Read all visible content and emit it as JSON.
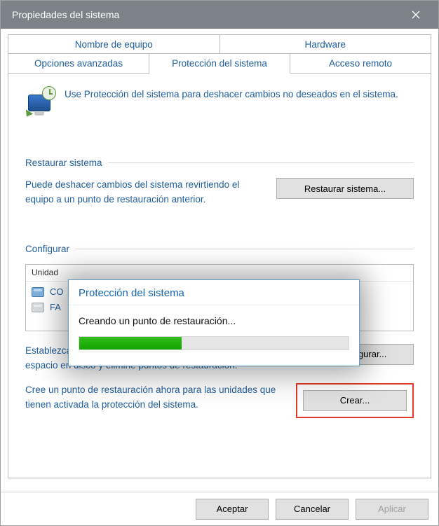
{
  "window": {
    "title": "Propiedades del sistema"
  },
  "tabs": {
    "row1": [
      {
        "label": "Nombre de equipo"
      },
      {
        "label": "Hardware"
      }
    ],
    "row2": [
      {
        "label": "Opciones avanzadas"
      },
      {
        "label": "Protección del sistema"
      },
      {
        "label": "Acceso remoto"
      }
    ]
  },
  "intro": "Use Protección del sistema para deshacer cambios no deseados en el sistema.",
  "section_restore": {
    "heading": "Restaurar sistema",
    "text": "Puede deshacer cambios del sistema revirtiendo el equipo a un punto de restauración anterior.",
    "button": "Restaurar sistema..."
  },
  "section_config": {
    "heading": "Configurar",
    "drives_header": "Unidad",
    "drives": [
      {
        "label": "CO"
      },
      {
        "label": "FA"
      }
    ],
    "config_text": "Establezca la configuración de restauración, administre el espacio en disco y elimine puntos de restauración.",
    "config_button": "Configurar...",
    "create_text": "Cree un punto de restauración ahora para las unidades que tienen activada la protección del sistema.",
    "create_button": "Crear..."
  },
  "footer": {
    "ok": "Aceptar",
    "cancel": "Cancelar",
    "apply": "Aplicar"
  },
  "modal": {
    "title": "Protección del sistema",
    "message": "Creando un punto de restauración...",
    "progress_pct": 38
  }
}
